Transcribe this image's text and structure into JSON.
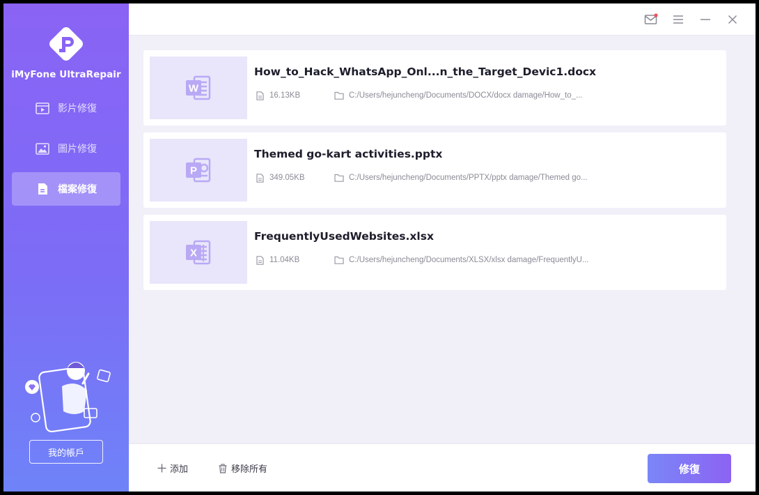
{
  "app": {
    "name": "iMyFone UltraRepair"
  },
  "sidebar": {
    "items": [
      {
        "label": "影片修復",
        "icon": "video-icon",
        "active": false
      },
      {
        "label": "圖片修復",
        "icon": "image-icon",
        "active": false
      },
      {
        "label": "檔案修復",
        "icon": "file-icon",
        "active": true
      }
    ],
    "account_label": "我的帳戶"
  },
  "files": [
    {
      "name": "How_to_Hack_WhatsApp_Onl...n_the_Target_Devic1.docx",
      "size": "16.13KB",
      "path": "C:/Users/hejuncheng/Documents/DOCX/docx damage/How_to_...",
      "type": "word-icon",
      "letter": "W"
    },
    {
      "name": "Themed go-kart activities.pptx",
      "size": "349.05KB",
      "path": "C:/Users/hejuncheng/Documents/PPTX/pptx damage/Themed go...",
      "type": "powerpoint-icon",
      "letter": "P"
    },
    {
      "name": "FrequentlyUsedWebsites.xlsx",
      "size": "11.04KB",
      "path": "C:/Users/hejuncheng/Documents/XLSX/xlsx damage/FrequentlyU...",
      "type": "excel-icon",
      "letter": "X"
    }
  ],
  "footer": {
    "add_label": "添加",
    "remove_all_label": "移除所有",
    "repair_label": "修復"
  },
  "colors": {
    "accent": "#8a63f5",
    "accent_secondary": "#6f83f8",
    "thumb_icon": "#b9a9f5"
  }
}
